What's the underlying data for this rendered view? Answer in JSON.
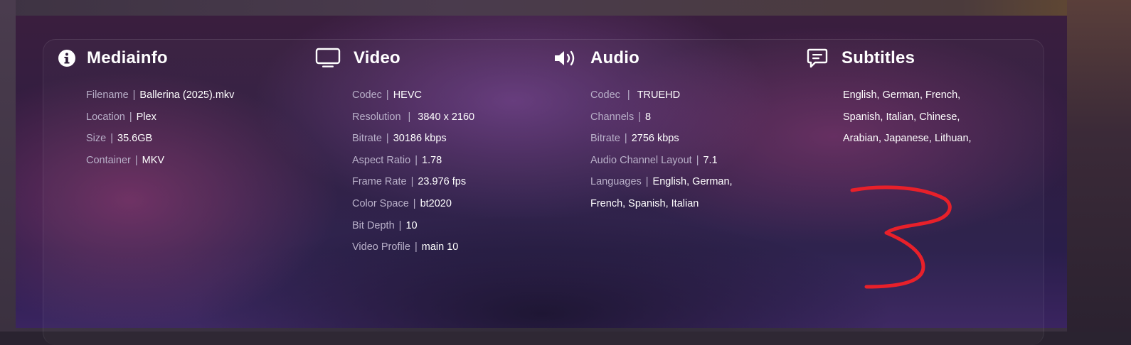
{
  "mediainfo": {
    "title": "Mediainfo",
    "rows": [
      {
        "key": "Filename",
        "value": "Ballerina (2025).mkv"
      },
      {
        "key": "Location",
        "value": "Plex"
      },
      {
        "key": "Size",
        "value": "35.6GB"
      },
      {
        "key": "Container",
        "value": "MKV"
      }
    ]
  },
  "video": {
    "title": "Video",
    "rows": [
      {
        "key": "Codec",
        "value": "HEVC"
      },
      {
        "key": "Resolution",
        "value": "3840 x 2160"
      },
      {
        "key": "Bitrate",
        "value": "30186 kbps"
      },
      {
        "key": "Aspect Ratio",
        "value": "1.78"
      },
      {
        "key": "Frame Rate",
        "value": "23.976 fps"
      },
      {
        "key": "Color Space",
        "value": "bt2020"
      },
      {
        "key": "Bit Depth",
        "value": "10"
      },
      {
        "key": "Video Profile",
        "value": "main 10"
      }
    ]
  },
  "audio": {
    "title": "Audio",
    "rows": [
      {
        "key": "Codec",
        "value": "TRUEHD"
      },
      {
        "key": "Channels",
        "value": "8"
      },
      {
        "key": "Bitrate",
        "value": "2756 kbps"
      },
      {
        "key": "Audio Channel Layout",
        "value": "7.1"
      },
      {
        "key": "Languages",
        "value": "English, German,"
      }
    ],
    "languages_continued": "French, Spanish, Italian"
  },
  "subtitles": {
    "title": "Subtitles",
    "lines": [
      "English, German, French,",
      "Spanish, Italian, Chinese,",
      "Arabian, Japanese, Lithuan,"
    ]
  },
  "separator": "|",
  "icons": {
    "mediainfo": "info-circle-icon",
    "video": "monitor-icon",
    "audio": "speaker-icon",
    "subtitles": "chat-bubble-icon"
  },
  "colors": {
    "label": "#b9b0c9",
    "value": "#ffffff",
    "annotation": "#e8202a"
  }
}
